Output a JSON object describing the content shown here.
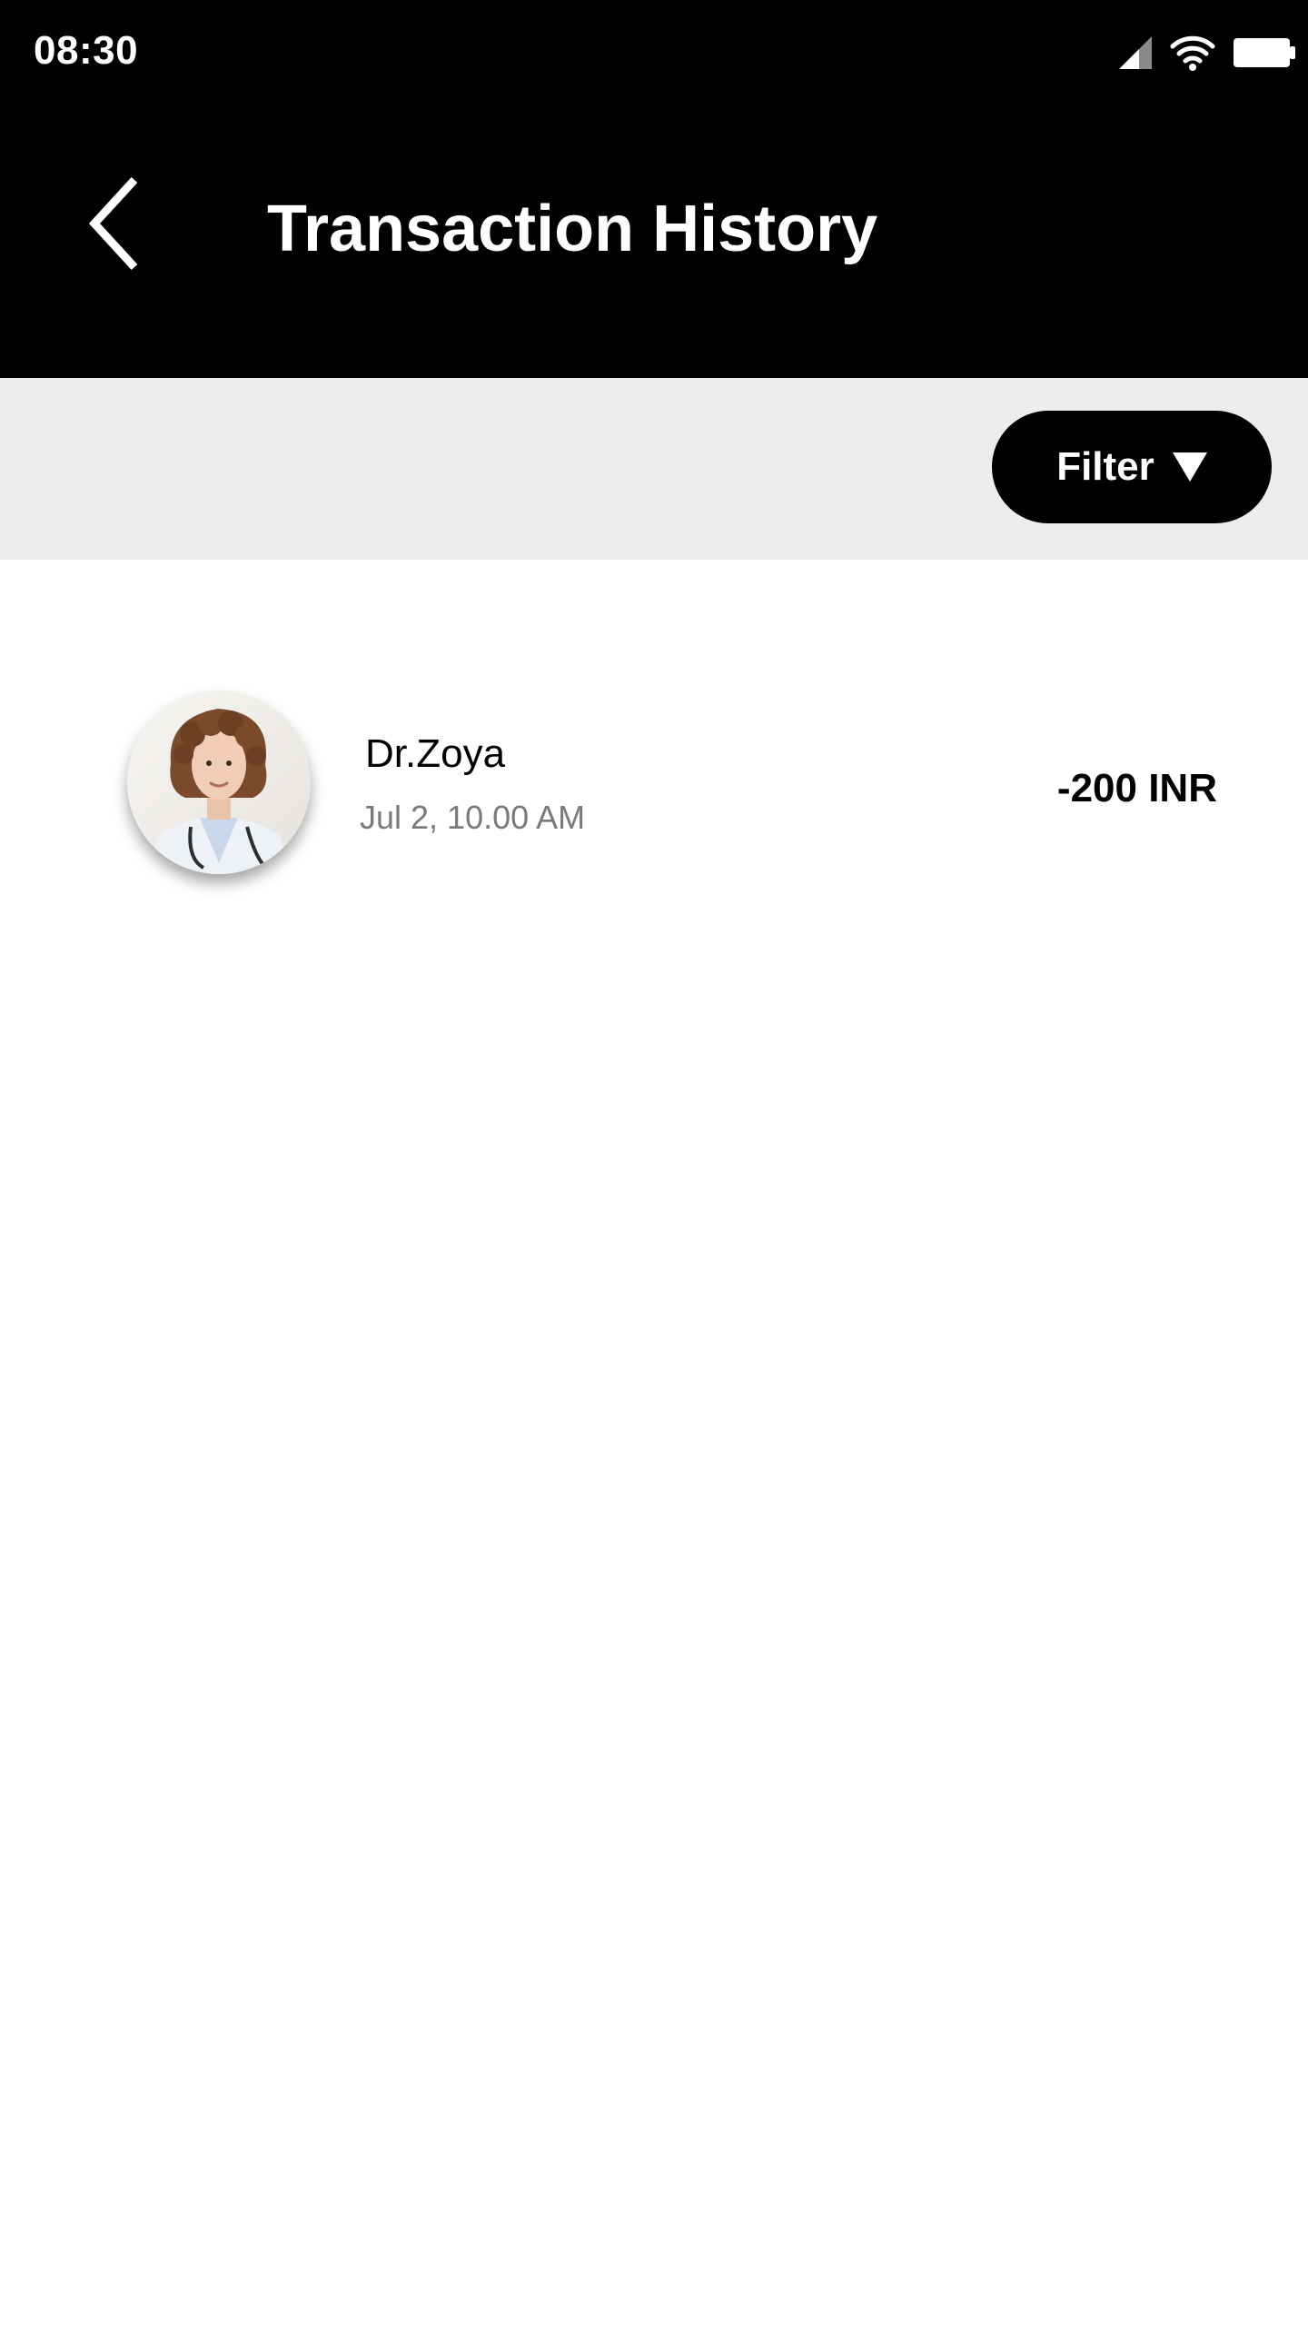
{
  "status_bar": {
    "time": "08:30",
    "icons": [
      "cellular-signal-icon",
      "wifi-icon",
      "battery-icon"
    ]
  },
  "header": {
    "title": "Transaction History",
    "back_icon": "chevron-left-icon"
  },
  "filter": {
    "label": "Filter",
    "icon": "caret-down-icon"
  },
  "transactions": [
    {
      "name": "Dr.Zoya",
      "datetime": "Jul 2, 10.00 AM",
      "amount": "-200 INR",
      "avatar": "doctor-avatar"
    }
  ],
  "colors": {
    "header_bg": "#000000",
    "filter_bar_bg": "#ededed",
    "filter_button_bg": "#000000",
    "text_primary": "#000000",
    "text_secondary": "#7a7a7a",
    "text_on_dark": "#ffffff"
  }
}
